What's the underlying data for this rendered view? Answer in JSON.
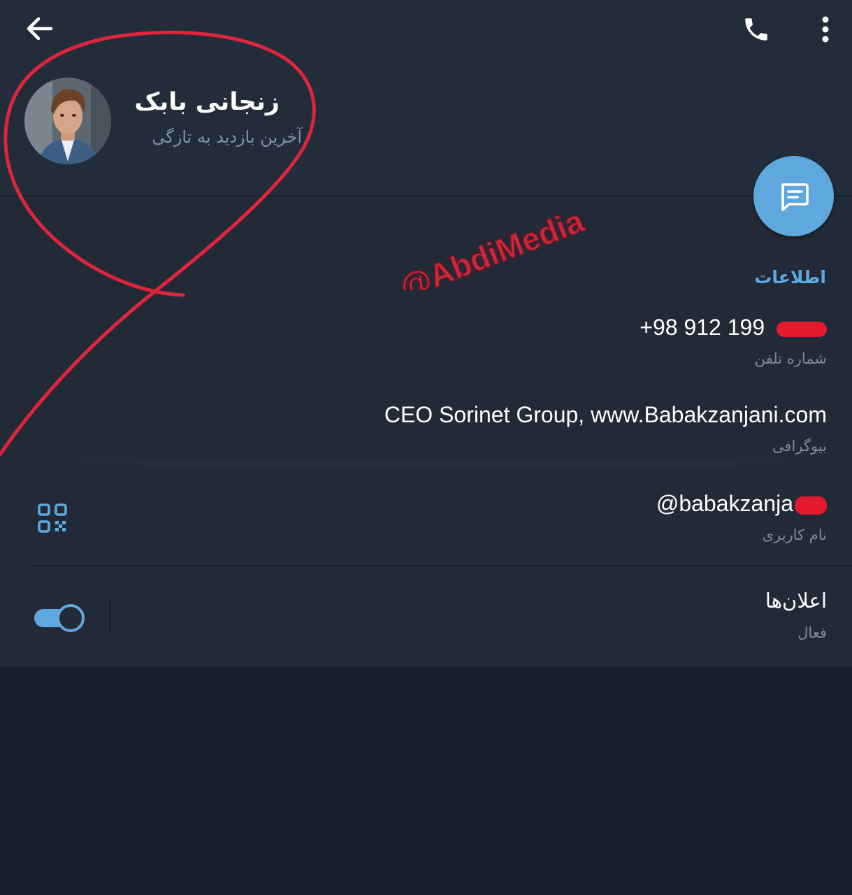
{
  "header": {
    "back_icon": "arrow-left-icon",
    "call_icon": "phone-icon",
    "more_icon": "more-vertical-icon",
    "name": "زنجانی بابک",
    "status": "آخرین بازدید به تازگی",
    "fab_icon": "message-icon"
  },
  "info": {
    "section_title": "اطلاعات",
    "phone": {
      "value": "+98 912 199",
      "label": "شماره تلفن"
    },
    "bio": {
      "value": "CEO Sorinet Group, www.Babakzanjani.com",
      "label": "بیوگرافی"
    },
    "username": {
      "value": "@babakzanja",
      "label": "نام کاربری",
      "qr_icon": "qr-code-icon"
    },
    "notifications": {
      "title": "اعلان‌ها",
      "status": "فعال",
      "enabled": true
    }
  },
  "overlay": {
    "watermark": "@AbdiMedia",
    "annotation_color": "#e0243b",
    "redaction_color": "#e31a2e"
  },
  "colors": {
    "accent": "#5fa8df",
    "header_bg": "#222c3a",
    "panel_bg": "#222a37",
    "page_bg": "#18202b"
  }
}
